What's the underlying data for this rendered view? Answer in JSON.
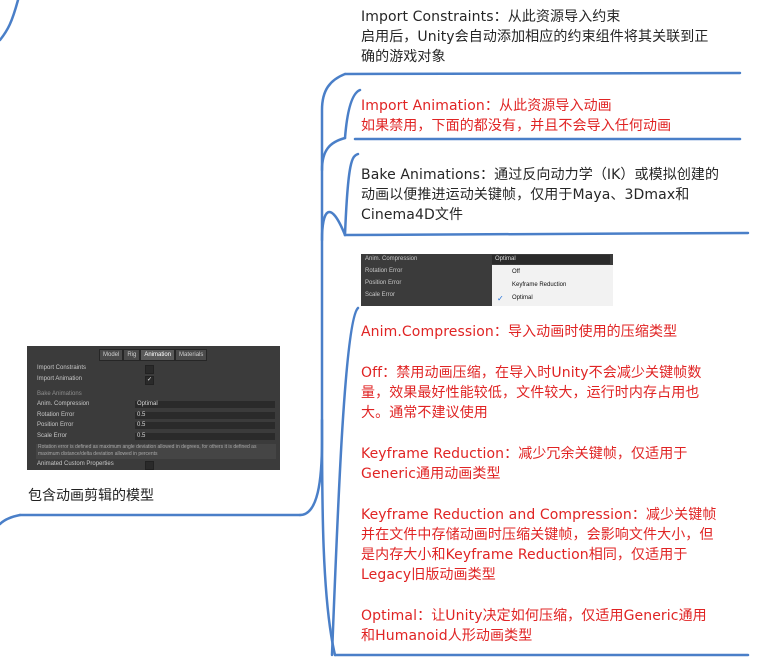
{
  "nodes": {
    "import_constraints": "Import Constraints：从此资源导入约束\n启用后，Unity会自动添加相应的约束组件将其关联到正\n确的游戏对象",
    "import_animation": "Import Animation：从此资源导入动画\n如果禁用，下面的都没有，并且不会导入任何动画",
    "bake_animations": "Bake Animations：通过反向动力学（IK）或模拟创建的\n动画以便推进运动关键帧，仅用于Maya、3Dmax和\nCinema4D文件",
    "anim_compression": "Anim.Compression：导入动画时使用的压缩类型",
    "off": "Off：禁用动画压缩，在导入时Unity不会减少关键帧数\n量，效果最好性能较低，文件较大，运行时内存占用也\n大。通常不建议使用",
    "keyframe_reduction": "Keyframe Reduction：减少冗余关键帧，仅适用于\nGeneric通用动画类型",
    "keyframe_reduction_compression": "Keyframe Reduction and Compression：减少关键帧\n并在文件中存储动画时压缩关键帧，会影响文件大小，但\n是内存大小和Keyframe Reduction相同，仅适用于\nLegacy旧版动画类型",
    "optimal": "Optimal：让Unity决定如何压缩，仅适用Generic通用\n和Humanoid人形动画类型",
    "root": "包含动画剪辑的模型"
  },
  "inspector": {
    "tabs": [
      "Model",
      "Rig",
      "Animation",
      "Materials"
    ],
    "active_tab": "Animation",
    "import_constraints": "Import Constraints",
    "import_animation": "Import Animation",
    "import_animation_check": "✓",
    "bake_animations": "Bake Animations",
    "anim_compression": "Anim. Compression",
    "anim_compression_value": "Optimal",
    "rotation_error": "Rotation Error",
    "rotation_error_value": "0.5",
    "position_error": "Position Error",
    "position_error_value": "0.5",
    "scale_error": "Scale Error",
    "scale_error_value": "0.5",
    "note": "Rotation error is defined as maximum angle deviation allowed in degrees, for others it is defined as maximum distance/delta deviation allowed in percents",
    "animated_custom_properties": "Animated Custom Properties"
  },
  "dropdown": {
    "anim_compression": "Anim. Compression",
    "selected": "Optimal",
    "rotation_error": "Rotation Error",
    "position_error": "Position Error",
    "scale_error": "Scale Error",
    "options": [
      "Off",
      "Keyframe Reduction",
      "Optimal"
    ],
    "checked_option": "Optimal",
    "check_glyph": "✓"
  },
  "colors": {
    "connector": "#4a7fc8",
    "red_text": "#e02424",
    "dark_text": "#262626"
  }
}
